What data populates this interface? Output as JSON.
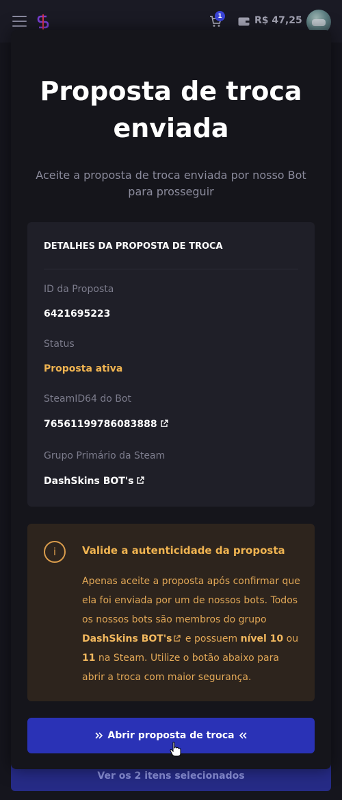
{
  "topbar": {
    "cart_count": "1",
    "balance": "R$ 47,25",
    "icons": {
      "menu": "hamburger-icon",
      "logo": "dashskins-logo-icon",
      "cart": "cart-icon",
      "wallet": "wallet-icon"
    }
  },
  "modal": {
    "title": "Proposta de troca enviada",
    "subtitle": "Aceite a proposta de troca enviada por nosso Bot para prosseguir",
    "details": {
      "heading": "DETALHES DA PROPOSTA DE TROCA",
      "fields": [
        {
          "label": "ID da Proposta",
          "value": "6421695223"
        },
        {
          "label": "Status",
          "value": "Proposta ativa"
        },
        {
          "label": "SteamID64 do Bot",
          "value": "76561199786083888"
        },
        {
          "label": "Grupo Primário da Steam",
          "value": "DashSkins BOT's"
        }
      ]
    },
    "warning": {
      "icon": "info-icon",
      "title": "Valide a autenticidade da proposta",
      "text_1": "Apenas aceite a proposta após confirmar que ela foi enviada por um de nossos bots. Todos os nossos bots são membros do grupo ",
      "group": "DashSkins BOT's",
      "text_2": " e possuem ",
      "level_1": "nível 10",
      "text_3": " ou ",
      "level_2": "11",
      "text_4": " na Steam. Utilize o botão abaixo para abrir a troca com maior segurança."
    },
    "open_button": "Abrir proposta de troca"
  },
  "selected_bar": "Ver os 2 itens selecionados",
  "colors": {
    "accent": "#2a32b6",
    "warning": "#f0b451",
    "background": "#15151d"
  }
}
